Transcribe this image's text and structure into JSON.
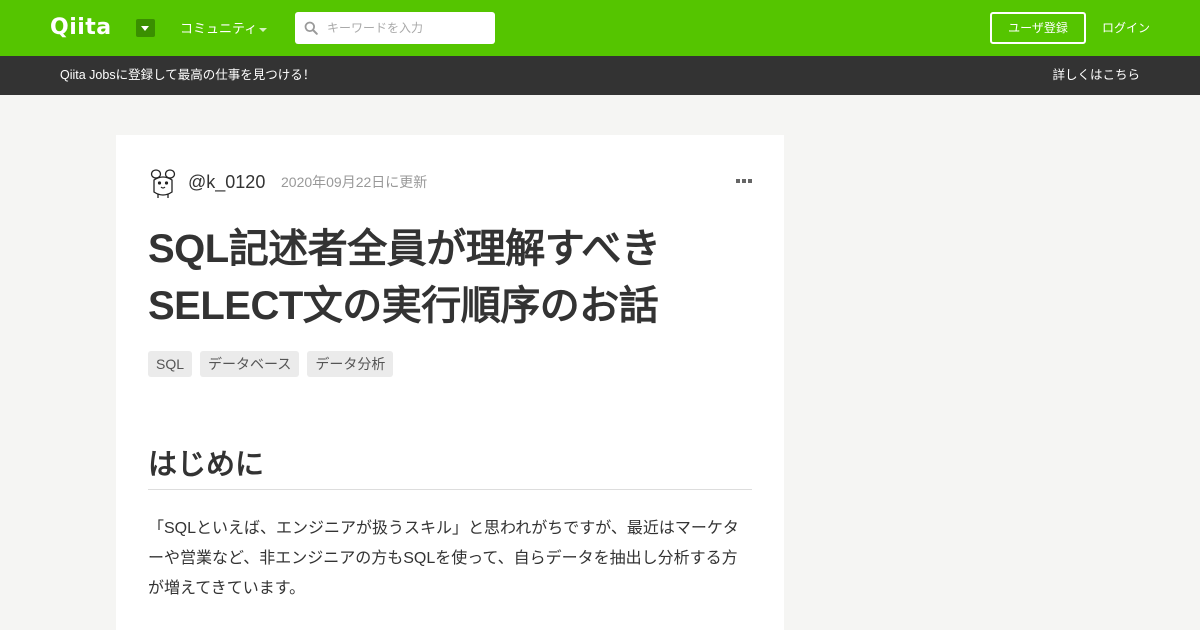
{
  "header": {
    "logo_text": "Qiita",
    "community_label": "コミュニティ",
    "search_placeholder": "キーワードを入力",
    "signup_label": "ユーザ登録",
    "login_label": "ログイン",
    "brand_color": "#55c500"
  },
  "banner": {
    "text": "Qiita Jobsに登録して最高の仕事を見つける！",
    "link": "詳しくはこちら"
  },
  "article": {
    "author": "@k_0120",
    "updated": "2020年09月22日に更新",
    "title_line1": "SQL記述者全員が理解すべき",
    "title_line2": "SELECT文の実行順序のお話",
    "tags": [
      "SQL",
      "データベース",
      "データ分析"
    ],
    "heading": "はじめに",
    "paragraph": "「SQLといえば、エンジニアが扱うスキル」と思われがちですが、最近はマーケターや営業など、非エンジニアの方もSQLを使って、自らデータを抽出し分析する方が増えてきています。"
  },
  "icons": {
    "search": "search-icon",
    "more": "more-options-icon",
    "avatar": "avatar-image",
    "dropdown": "chevron-down-icon"
  }
}
